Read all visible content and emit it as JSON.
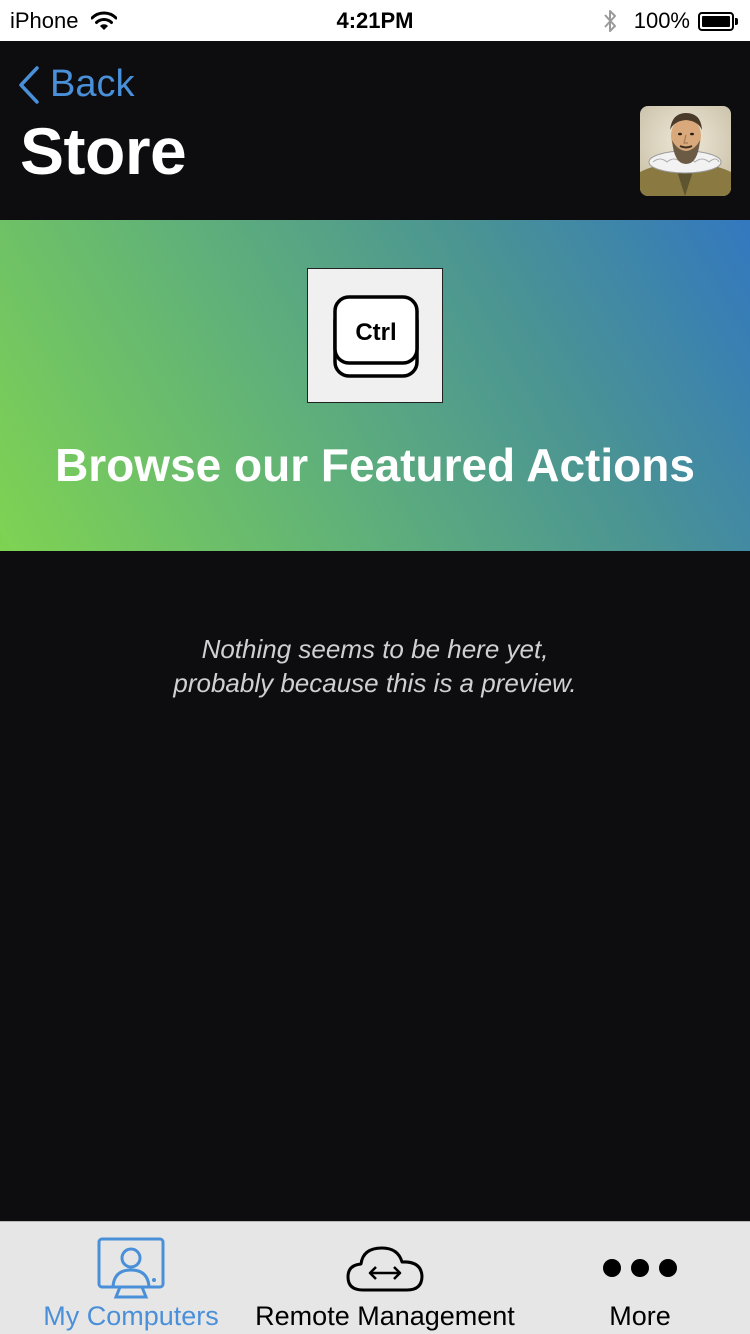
{
  "status_bar": {
    "carrier": "iPhone",
    "time": "4:21PM",
    "battery": "100%",
    "icons": [
      "wifi-icon",
      "bluetooth-icon",
      "battery-icon"
    ]
  },
  "nav": {
    "back_label": "Back",
    "title": "Store",
    "avatar": "profile-avatar"
  },
  "banner": {
    "icon_text": "Ctrl",
    "title": "Browse our Featured Actions"
  },
  "empty_state": {
    "line1": "Nothing seems to be here yet,",
    "line2": "probably because this is a preview."
  },
  "tab_bar": {
    "tabs": [
      {
        "label": "My Computers",
        "icon": "computer-user-icon",
        "active": true
      },
      {
        "label": "Remote Management",
        "icon": "cloud-transfer-icon",
        "active": false
      },
      {
        "label": "More",
        "icon": "more-dots-icon",
        "active": false
      }
    ]
  },
  "colors": {
    "accent": "#4a90d9",
    "background": "#0d0d0f",
    "banner_gradient_start": "#7fd352",
    "banner_gradient_end": "#3378bf",
    "tab_bar_bg": "#e6e6e6"
  }
}
